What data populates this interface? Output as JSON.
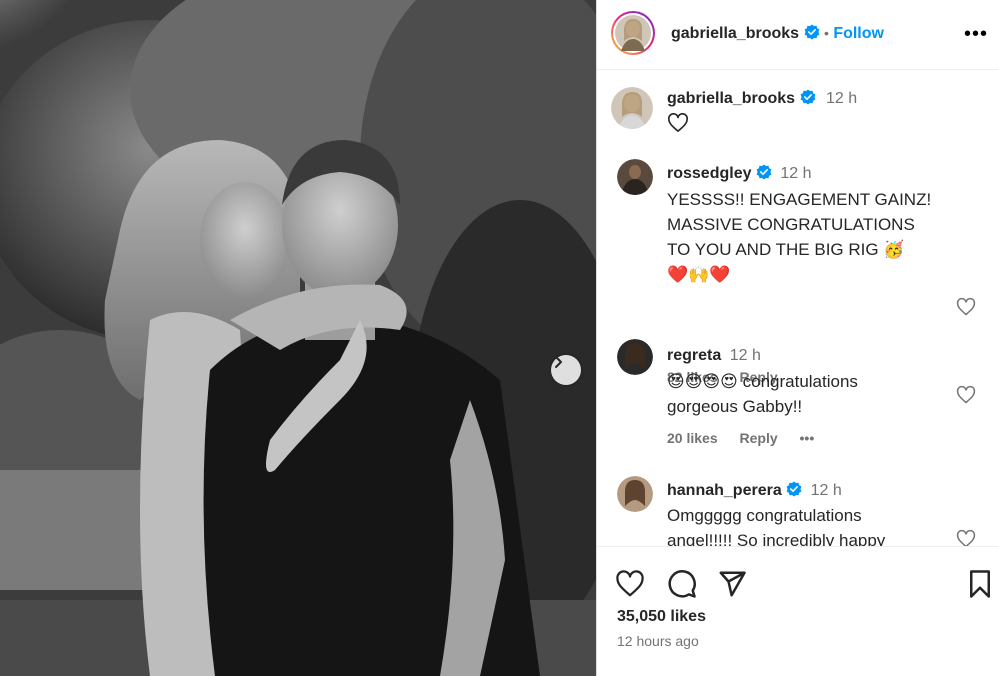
{
  "post": {
    "author": "gabriella_brooks",
    "follow_label": "Follow",
    "dot": "•",
    "more_label": "•••",
    "caption_time": "12 h",
    "likes": "35,050 likes",
    "posted_ago": "12 hours ago"
  },
  "comments": [
    {
      "user": "rossedgley",
      "verified": true,
      "time": "12 h",
      "lines": [
        "YESSSS!! ENGAGEMENT GAINZ!",
        "MASSIVE CONGRATULATIONS",
        "TO YOU AND THE BIG RIG 🥳",
        "❤️🙌❤️"
      ],
      "likes": "82 likes",
      "reply": "Reply"
    },
    {
      "user": "regreta",
      "verified": false,
      "time": "12 h",
      "lines": [
        "😍😍😍😍 congratulations",
        "gorgeous Gabby!!"
      ],
      "likes": "20 likes",
      "reply": "Reply",
      "more": "•••"
    },
    {
      "user": "hannah_perera",
      "verified": true,
      "time": "12 h",
      "lines": [
        "Omggggg congratulations",
        "angel!!!!! So incredibly happy"
      ]
    }
  ],
  "colors": {
    "accent": "#0095f6",
    "verified": "#0095f6",
    "muted": "#737373"
  }
}
